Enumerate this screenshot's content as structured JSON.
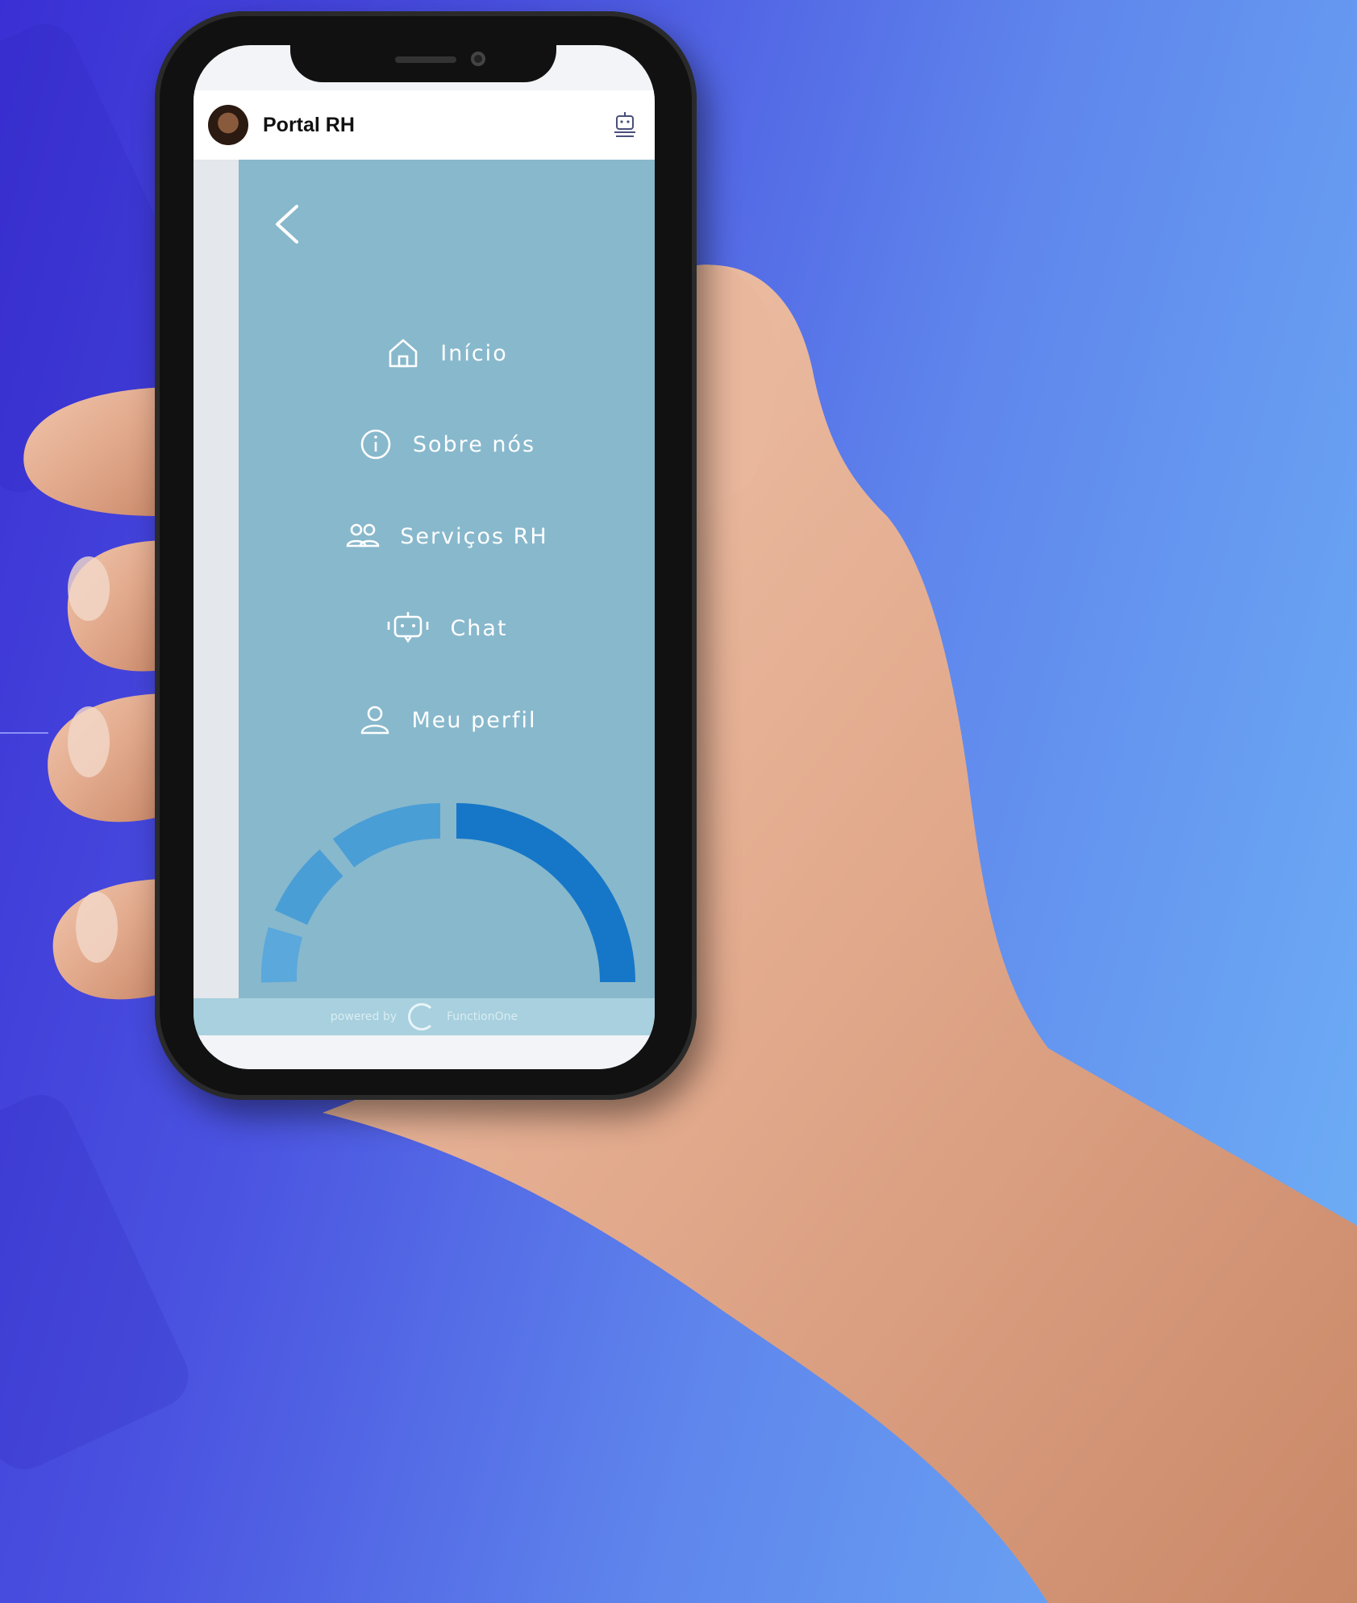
{
  "app": {
    "title": "Portal RH"
  },
  "drawer": {
    "items": [
      {
        "label": "Início",
        "icon": "home-icon"
      },
      {
        "label": "Sobre nós",
        "icon": "info-icon"
      },
      {
        "label": "Serviços RH",
        "icon": "people-icon"
      },
      {
        "label": "Chat",
        "icon": "chatbot-icon"
      },
      {
        "label": "Meu perfil",
        "icon": "user-icon"
      }
    ]
  },
  "footer": {
    "powered_label": "powered by",
    "brand": "FunctionOne"
  },
  "colors": {
    "drawer_bg": "#88b8cc",
    "arc_dark": "#1677c8",
    "arc_light": "#4a9ed6"
  }
}
